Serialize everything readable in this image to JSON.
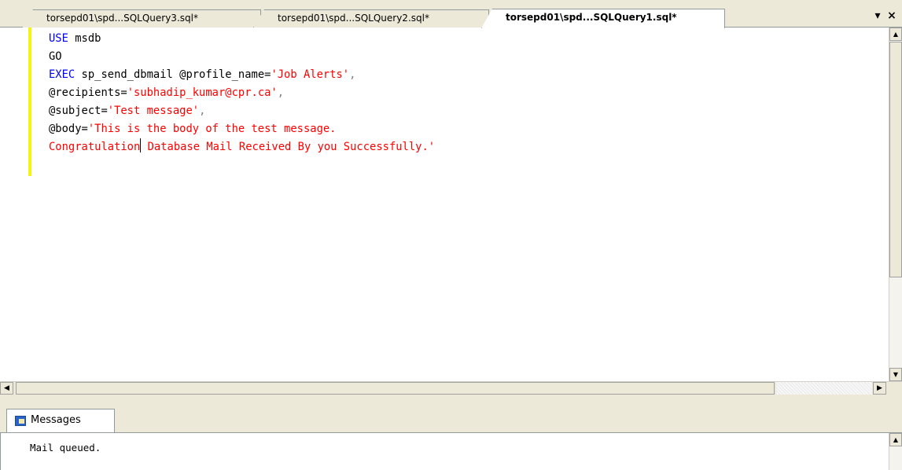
{
  "tabs": [
    {
      "label": "torsepd01\\spd...SQLQuery3.sql*",
      "active": false
    },
    {
      "label": "torsepd01\\spd...SQLQuery2.sql*",
      "active": false
    },
    {
      "label": "torsepd01\\spd...SQLQuery1.sql*",
      "active": true
    }
  ],
  "tab_controls": {
    "menu": "▾",
    "close": "×"
  },
  "code_lines": [
    {
      "l1a": "USE",
      "l1b": " msdb"
    },
    {
      "l2": "GO"
    },
    {
      "l3a": "EXEC",
      "l3b": " sp_send_dbmail @profile_name=",
      "l3c": "'Job Alerts'",
      "l3d": ","
    },
    {
      "l4a": "@recipients=",
      "l4b": "'subhadip_kumar@cpr.ca'",
      "l4c": ","
    },
    {
      "l5a": "@subject=",
      "l5b": "'Test message'",
      "l5c": ","
    },
    {
      "l6a": "@body=",
      "l6b": "'This is the body of the test message."
    },
    {
      "l7a": "Congratulation",
      "l7b": " Database Mail Received By you Successfully.'"
    }
  ],
  "results": {
    "tab_label": "Messages",
    "message": "Mail queued."
  },
  "colors": {
    "keyword": "#0000ff",
    "string": "#ff0000",
    "changebar": "#f4f412"
  }
}
